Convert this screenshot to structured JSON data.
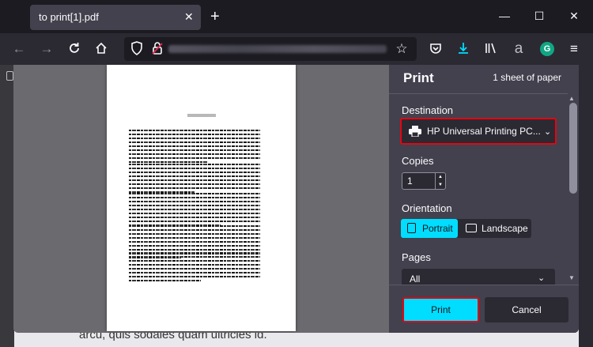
{
  "tab": {
    "title": "to print[1].pdf",
    "close_glyph": "✕"
  },
  "newtab_glyph": "+",
  "window_controls": {
    "minimize": "—",
    "maximize": "☐",
    "close": "✕"
  },
  "toolbar_icons": {
    "back": "arrow-left-icon",
    "forward": "arrow-right-icon",
    "reload": "reload-icon",
    "home": "home-icon",
    "bookmark": "star-icon",
    "pocket": "pocket-icon",
    "downloads": "download-icon",
    "library": "library-icon",
    "extension_a": "a-extension-icon",
    "grammarly": "G",
    "menu": "hamburger-menu-icon"
  },
  "background_text": "arcu, quis sodales quam ultricies id.",
  "print_panel": {
    "title": "Print",
    "sheets": "1 sheet of paper",
    "destination_label": "Destination",
    "destination_value": "HP Universal Printing PC...",
    "copies_label": "Copies",
    "copies_value": "1",
    "orientation_label": "Orientation",
    "orientation_portrait": "Portrait",
    "orientation_landscape": "Landscape",
    "pages_label": "Pages",
    "pages_value": "All",
    "print_button": "Print",
    "cancel_button": "Cancel"
  },
  "colors": {
    "accent": "#00ddff",
    "highlight_border": "#e30613",
    "panel_bg": "#42414d",
    "toolbar_bg": "#2b2a33"
  }
}
